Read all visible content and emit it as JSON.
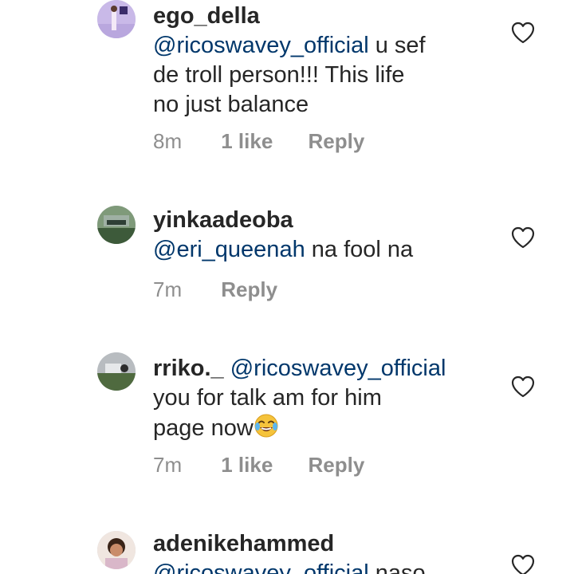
{
  "comments": [
    {
      "username": "ego_della",
      "mention": "@ricoswavey_official",
      "lines": [
        "u sef",
        "de troll person!!! This life",
        "no just balance"
      ],
      "time": "8m",
      "likes": "1 like",
      "reply": "Reply"
    },
    {
      "username": "yinkaadeoba",
      "mention": "@eri_queenah",
      "lines": [
        "na fool na"
      ],
      "time": "7m",
      "reply": "Reply"
    },
    {
      "username": "rriko._",
      "mention": "@ricoswavey_official",
      "lines": [
        "you for talk am for him",
        "page now"
      ],
      "emoji": "face-with-tears-of-joy",
      "time": "7m",
      "likes": "1 like",
      "reply": "Reply"
    },
    {
      "username": "adenikehammed",
      "mention": "@ricoswavey_official",
      "lines": [
        "naso"
      ]
    }
  ],
  "icons": {
    "like": "heart-outline-icon"
  },
  "colors": {
    "mention": "#00376b",
    "meta": "#8e8e8e",
    "text": "#262626"
  }
}
